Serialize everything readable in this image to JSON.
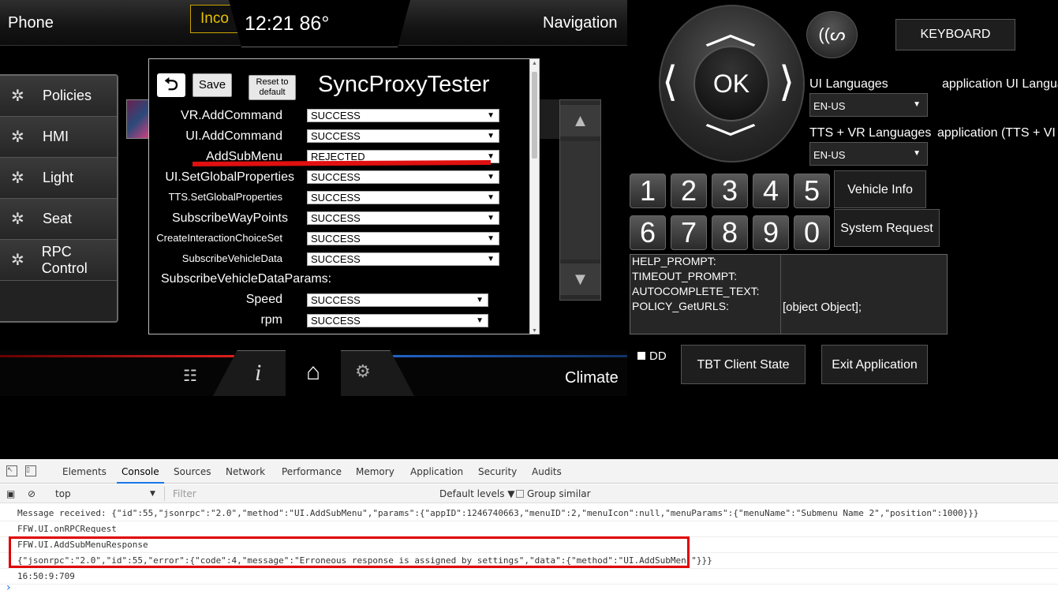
{
  "hmi": {
    "topbar": {
      "phone": "Phone",
      "incoming": "Inco",
      "clock": "12:21 86°",
      "navigation": "Navigation"
    },
    "sidebar": [
      {
        "label": "Policies",
        "icon": "gear-icon"
      },
      {
        "label": "HMI",
        "icon": "gear-icon"
      },
      {
        "label": "Light",
        "icon": "gear-icon"
      },
      {
        "label": "Seat",
        "icon": "gear-icon"
      },
      {
        "label": "RPC Control",
        "icon": "gear-icon"
      }
    ],
    "bottombar": {
      "climate": "Climate"
    }
  },
  "tester": {
    "back_icon": "back-arrow-icon",
    "save": "Save",
    "reset": "Reset to default",
    "title": "SyncProxyTester",
    "rows": [
      {
        "label": "VR.AddCommand",
        "value": "SUCCESS"
      },
      {
        "label": "UI.AddCommand",
        "value": "SUCCESS"
      },
      {
        "label": "AddSubMenu",
        "value": "REJECTED"
      },
      {
        "label": "UI.SetGlobalProperties",
        "value": "SUCCESS"
      },
      {
        "label": "TTS.SetGlobalProperties",
        "value": "SUCCESS"
      },
      {
        "label": "SubscribeWayPoints",
        "value": "SUCCESS"
      },
      {
        "label": "CreateInteractionChoiceSet",
        "value": "SUCCESS"
      },
      {
        "label": "SubscribeVehicleData",
        "value": "SUCCESS"
      }
    ],
    "params_heading": "SubscribeVehicleDataParams:",
    "params": [
      {
        "label": "Speed",
        "value": "SUCCESS"
      },
      {
        "label": "rpm",
        "value": "SUCCESS"
      }
    ]
  },
  "right_panel": {
    "ok": "OK",
    "keyboard": "KEYBOARD",
    "ui_languages": "UI Languages",
    "ui_languages_app": "application UI Langua",
    "ui_lang_value": "EN-US",
    "tts_vr_languages": "TTS + VR Languages",
    "tts_vr_app": "application (TTS + VI",
    "tts_lang_value": "EN-US",
    "numbers": [
      "1",
      "2",
      "3",
      "4",
      "5",
      "6",
      "7",
      "8",
      "9",
      "0"
    ],
    "vehicle_info": "Vehicle Info",
    "system_request": "System Request",
    "prompts": [
      "HELP_PROMPT:",
      "TIMEOUT_PROMPT:",
      "AUTOCOMPLETE_TEXT:",
      "POLICY_GetURLS:"
    ],
    "prompt_value": "[object Object];",
    "dd": "DD",
    "tbt": "TBT Client State",
    "exit": "Exit Application"
  },
  "devtools": {
    "tabs": [
      "Elements",
      "Console",
      "Sources",
      "Network",
      "Performance",
      "Memory",
      "Application",
      "Security",
      "Audits"
    ],
    "active_tab": "Console",
    "context": "top",
    "filter_placeholder": "Filter",
    "levels": "Default levels ▼",
    "group_similar": "Group similar",
    "logs": [
      "Message received: {\"id\":55,\"jsonrpc\":\"2.0\",\"method\":\"UI.AddSubMenu\",\"params\":{\"appID\":1246740663,\"menuID\":2,\"menuIcon\":null,\"menuParams\":{\"menuName\":\"Submenu Name 2\",\"position\":1000}}}",
      "FFW.UI.onRPCRequest",
      "FFW.UI.AddSubMenuResponse",
      "{\"jsonrpc\":\"2.0\",\"id\":55,\"error\":{\"code\":4,\"message\":\"Erroneous response is assigned by settings\",\"data\":{\"method\":\"UI.AddSubMen \"}}}",
      "16:50:9:709"
    ]
  }
}
